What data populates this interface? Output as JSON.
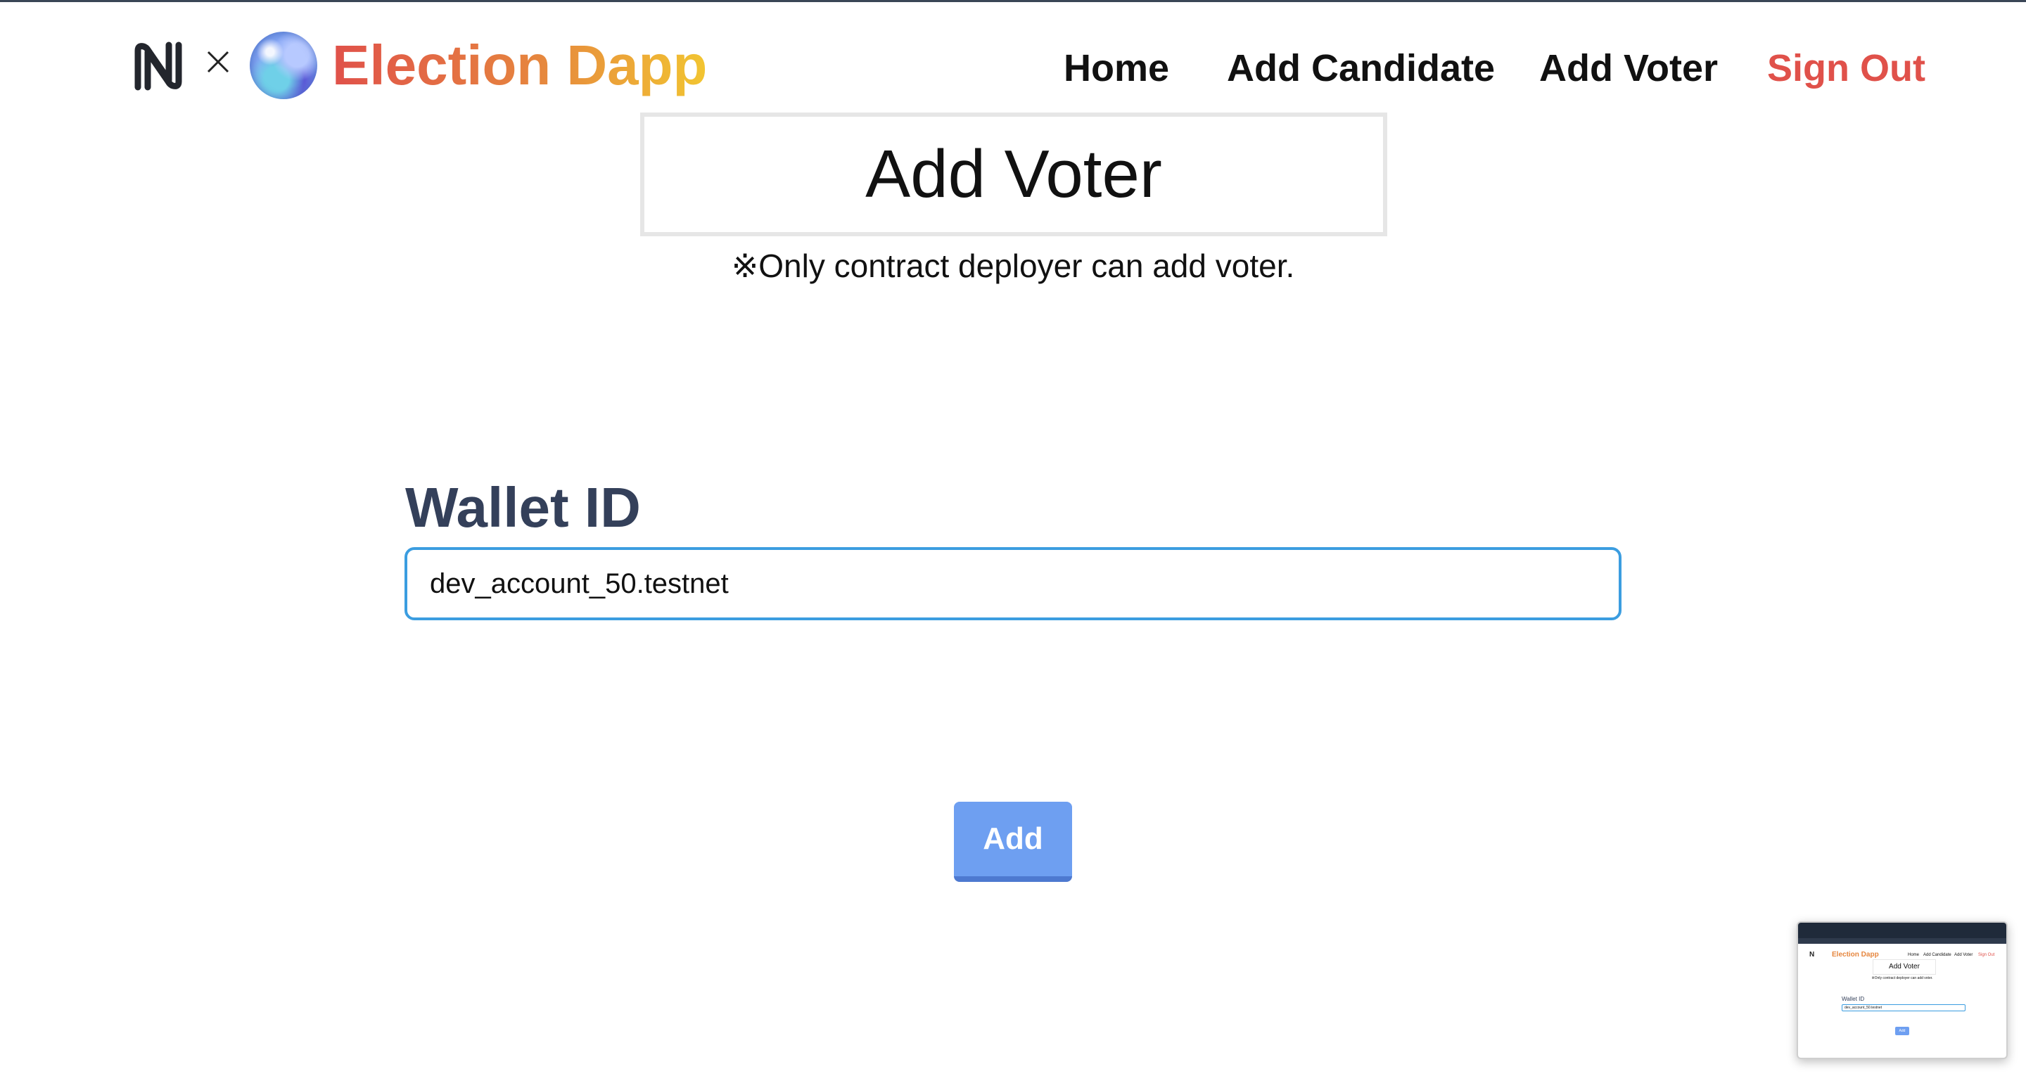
{
  "header": {
    "logo_times": "×",
    "brand": "Election Dapp",
    "nav": {
      "home": "Home",
      "add_candidate": "Add Candidate",
      "add_voter": "Add Voter",
      "sign_out": "Sign Out"
    }
  },
  "main": {
    "title": "Add Voter",
    "subtitle": "※Only contract deployer can add voter.",
    "form": {
      "wallet_label": "Wallet ID",
      "wallet_value": "dev_account_50.testnet",
      "add_button": "Add"
    }
  },
  "colors": {
    "brand_gradient_start": "#e0514a",
    "brand_gradient_end": "#f2c531",
    "sign_out": "#e0514a",
    "input_border": "#3b9de0",
    "button": "#6e9ff1",
    "label": "#34405a"
  },
  "icons": {
    "near_logo": "near-logo-icon",
    "times": "times-icon",
    "orb": "orb-logo-icon"
  }
}
